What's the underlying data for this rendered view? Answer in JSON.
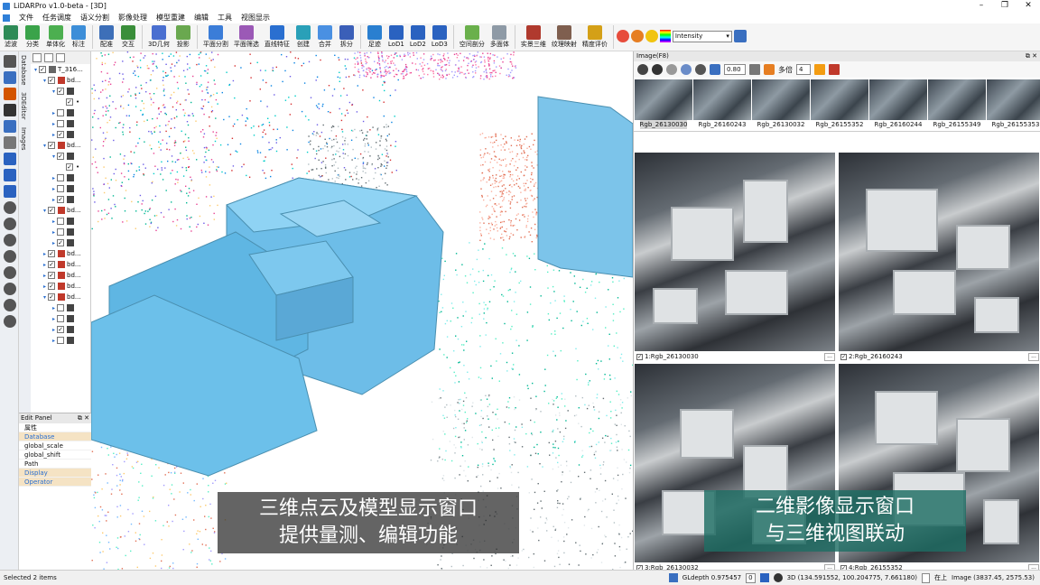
{
  "window": {
    "title": "LiDARPro v1.0-beta - [3D]"
  },
  "menu": [
    "文件",
    "任务调度",
    "语义分割",
    "影像处理",
    "模型重建",
    "编辑",
    "工具",
    "视图显示"
  ],
  "toolbar": [
    {
      "label": "滤波",
      "color": "#2e8b57",
      "icon": "filter-icon"
    },
    {
      "label": "分类",
      "color": "#3aa34a",
      "icon": "classify-icon"
    },
    {
      "label": "单体化",
      "color": "#4caf50",
      "icon": "single-icon"
    },
    {
      "label": "标注",
      "color": "#3d8ed8",
      "icon": "label-icon"
    },
    {
      "label": "配准",
      "color": "#3d6fb8",
      "icon": "register-icon"
    },
    {
      "label": "交互",
      "color": "#3a8e3a",
      "icon": "interact-icon"
    },
    {
      "label": "3D几何",
      "color": "#4a6fd0",
      "icon": "3d-geometry-icon"
    },
    {
      "label": "投影",
      "color": "#6aa84f",
      "icon": "projection-icon"
    },
    {
      "label": "平面分割",
      "color": "#3b7dd8",
      "icon": "plane-seg-icon"
    },
    {
      "label": "平面筛选",
      "color": "#9b59b6",
      "icon": "plane-filter-icon"
    },
    {
      "label": "直线特征",
      "color": "#2a6fd0",
      "icon": "line-feature-icon"
    },
    {
      "label": "创建",
      "color": "#2aa0b8",
      "icon": "create-icon"
    },
    {
      "label": "合并",
      "color": "#4a90e2",
      "icon": "merge-icon"
    },
    {
      "label": "拆分",
      "color": "#3b5fb8",
      "icon": "split-icon"
    },
    {
      "label": "足迹",
      "color": "#2a7fd0",
      "icon": "footprint-icon"
    },
    {
      "label": "LoD1",
      "color": "#2a62c0",
      "icon": "lod1-icon"
    },
    {
      "label": "LoD2",
      "color": "#2a62c0",
      "icon": "lod2-icon"
    },
    {
      "label": "LoD3",
      "color": "#2a62c0",
      "icon": "lod3-icon"
    },
    {
      "label": "空间剖分",
      "color": "#6ab04c",
      "icon": "space-partition-icon"
    },
    {
      "label": "多面体",
      "color": "#8e9aa6",
      "icon": "polyhedron-icon"
    },
    {
      "label": "实景三维",
      "color": "#b03a2e",
      "icon": "realistic-3d-icon"
    },
    {
      "label": "纹理映射",
      "color": "#7f5f4f",
      "icon": "texture-icon"
    },
    {
      "label": "精度评价",
      "color": "#d4a017",
      "icon": "accuracy-icon"
    }
  ],
  "color_select": "Intensity",
  "side_tabs": [
    "Database",
    "3DEditor",
    "Images"
  ],
  "tree": [
    {
      "indent": 0,
      "arrow": "▾",
      "checked": true,
      "label": "T_316...",
      "icon": "#666"
    },
    {
      "indent": 1,
      "arrow": "▾",
      "checked": true,
      "label": "bd...",
      "icon": "#c0392b"
    },
    {
      "indent": 2,
      "arrow": "▾",
      "checked": true,
      "label": "",
      "icon": "#444"
    },
    {
      "indent": 3,
      "arrow": "",
      "checked": true,
      "label": "•",
      "icon": ""
    },
    {
      "indent": 2,
      "arrow": "▸",
      "checked": false,
      "label": "",
      "icon": "#444"
    },
    {
      "indent": 2,
      "arrow": "▸",
      "checked": false,
      "label": "",
      "icon": "#444"
    },
    {
      "indent": 2,
      "arrow": "▸",
      "checked": true,
      "label": "",
      "icon": "#444"
    },
    {
      "indent": 1,
      "arrow": "▾",
      "checked": true,
      "label": "bd...",
      "icon": "#c0392b"
    },
    {
      "indent": 2,
      "arrow": "▾",
      "checked": true,
      "label": "",
      "icon": "#444"
    },
    {
      "indent": 3,
      "arrow": "",
      "checked": true,
      "label": "•",
      "icon": ""
    },
    {
      "indent": 2,
      "arrow": "▸",
      "checked": false,
      "label": "",
      "icon": "#444"
    },
    {
      "indent": 2,
      "arrow": "▸",
      "checked": false,
      "label": "",
      "icon": "#444"
    },
    {
      "indent": 2,
      "arrow": "▸",
      "checked": true,
      "label": "",
      "icon": "#444"
    },
    {
      "indent": 1,
      "arrow": "▾",
      "checked": true,
      "label": "bd...",
      "icon": "#c0392b"
    },
    {
      "indent": 2,
      "arrow": "▸",
      "checked": false,
      "label": "",
      "icon": "#444"
    },
    {
      "indent": 2,
      "arrow": "▸",
      "checked": false,
      "label": "",
      "icon": "#444"
    },
    {
      "indent": 2,
      "arrow": "▸",
      "checked": true,
      "label": "",
      "icon": "#444"
    },
    {
      "indent": 1,
      "arrow": "▸",
      "checked": true,
      "label": "bd...",
      "icon": "#c0392b"
    },
    {
      "indent": 1,
      "arrow": "▸",
      "checked": true,
      "label": "bd...",
      "icon": "#c0392b"
    },
    {
      "indent": 1,
      "arrow": "▸",
      "checked": true,
      "label": "bd...",
      "icon": "#c0392b"
    },
    {
      "indent": 1,
      "arrow": "▸",
      "checked": true,
      "label": "bd...",
      "icon": "#c0392b"
    },
    {
      "indent": 1,
      "arrow": "▾",
      "checked": true,
      "label": "bd...",
      "icon": "#c0392b"
    },
    {
      "indent": 2,
      "arrow": "▸",
      "checked": false,
      "label": "",
      "icon": "#444"
    },
    {
      "indent": 2,
      "arrow": "▸",
      "checked": false,
      "label": "",
      "icon": "#444"
    },
    {
      "indent": 2,
      "arrow": "▸",
      "checked": true,
      "label": "",
      "icon": "#444"
    },
    {
      "indent": 2,
      "arrow": "▸",
      "checked": false,
      "label": "",
      "icon": "#444"
    }
  ],
  "edit_panel": {
    "title": "Edit Panel",
    "header": "属性",
    "rows": [
      {
        "label": "Database",
        "section": true
      },
      {
        "label": "global_scale",
        "section": false
      },
      {
        "label": "global_shift",
        "section": false
      },
      {
        "label": "Path",
        "section": false
      },
      {
        "label": "Display",
        "section": true
      },
      {
        "label": "Operator",
        "section": true
      }
    ]
  },
  "captions": {
    "left": [
      "三维点云及模型显示窗口",
      "提供量测、编辑功能"
    ],
    "right": [
      "二维影像显示窗口",
      "与三维视图联动"
    ]
  },
  "image_panel": {
    "title": "Image(F8)",
    "opacity": "0.80",
    "mode_label": "多倍",
    "mode_value": "4",
    "thumbs": [
      "Rgb_26130030",
      "Rgb_26160243",
      "Rgb_26130032",
      "Rgb_26155352",
      "Rgb_26160244",
      "Rgb_26155349",
      "Rgb_26155353"
    ],
    "cells": [
      "1:Rgb_26130030",
      "2:Rgb_26160243",
      "3:Rgb_26130032",
      "4:Rgb_26155352"
    ]
  },
  "status": {
    "left": "Selected 2 items",
    "gldepth": "GLdepth 0.975457",
    "depth_value": "0",
    "view": "3D (134.591552, 100.204775, 7.661180)",
    "topmost": "在上",
    "image_coord": "Image (3837.45, 2575.53)"
  }
}
